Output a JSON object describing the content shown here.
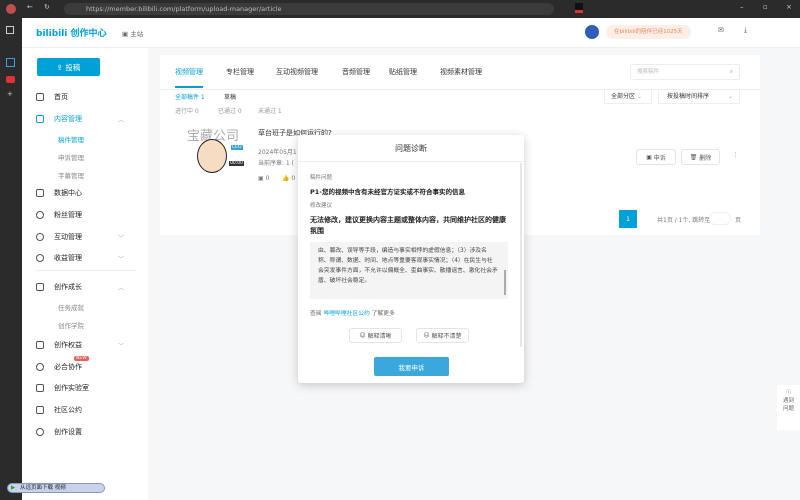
{
  "browser": {
    "url": "https://member.bilibili.com/platform/upload-manager/article"
  },
  "header": {
    "logo": "bilibili 创作中心",
    "home_link": "主站",
    "promo": "在bilibili的陪伴已经1025天",
    "colors": {
      "brand": "#00a1d6"
    }
  },
  "sidebar": {
    "upload_button": "投稿",
    "items": [
      {
        "label": "首页"
      },
      {
        "label": "内容管理",
        "subs": [
          "稿件管理",
          "申诉管理",
          "字幕管理"
        ]
      },
      {
        "label": "数据中心"
      },
      {
        "label": "粉丝管理"
      },
      {
        "label": "互动管理"
      },
      {
        "label": "收益管理"
      },
      {
        "label": "创作成长",
        "subs": [
          "任务成就",
          "创作学院"
        ]
      },
      {
        "label": "创作权益"
      },
      {
        "label": "必合协作",
        "badge": "NEW"
      },
      {
        "label": "创作实验室"
      },
      {
        "label": "社区公约"
      },
      {
        "label": "创作设置"
      }
    ]
  },
  "main": {
    "tabs": [
      "视频管理",
      "专栏管理",
      "互动视频管理",
      "音频管理",
      "贴纸管理",
      "视频素材管理"
    ],
    "search_placeholder": "搜索稿件",
    "filters": {
      "all": "全部稿件 1",
      "draft": "草稿",
      "in_progress": "进行中 0",
      "passed": "已通过 0",
      "failed": "未通过 1",
      "zone": "全部分区",
      "sort": "按投稿时间排序"
    },
    "video": {
      "title": "草台班子是如何运行的?",
      "date": "2024年05月1",
      "episode": "当前序章: 1 (",
      "duration": "00:00",
      "thumb_text": "宝藏公司",
      "thumb_badge": "CEO",
      "stats": [
        "0",
        "0"
      ],
      "appeal": "申诉",
      "delete": "删除"
    },
    "pagination": {
      "current": "1",
      "summary": "共1页 / 1个, 跳转至",
      "page_suffix": "页"
    }
  },
  "dialog": {
    "title": "问题诊断",
    "problem_label": "稿件问题",
    "problem": "P1-您的视频中含有未经官方证实或不符合事实的信息",
    "suggest_label": "修改建议",
    "suggestion": "无法修改，建议更换内容主题或整体内容，共同维护社区的健康氛围",
    "detail": "由、篡改、误导等手段，编造与事实相悖的虚假信息；（3）涉及名称、称谓、数据、时间、地点等重要客观事实情况；（4）在民生与社会突发事件方面，不允许以偏概全、歪曲事实、散播谣言、激化社会矛盾、破坏社会稳定。",
    "see_prefix": "查阅",
    "see_link": "哔哩哔哩社区公约",
    "see_suffix": "了解更多",
    "helpful": "解释清晰",
    "unhelpful": "解释不清楚",
    "appeal_button": "我要申诉"
  },
  "float_help": "遇到问题",
  "download_bar": "从远页面下载 视频"
}
